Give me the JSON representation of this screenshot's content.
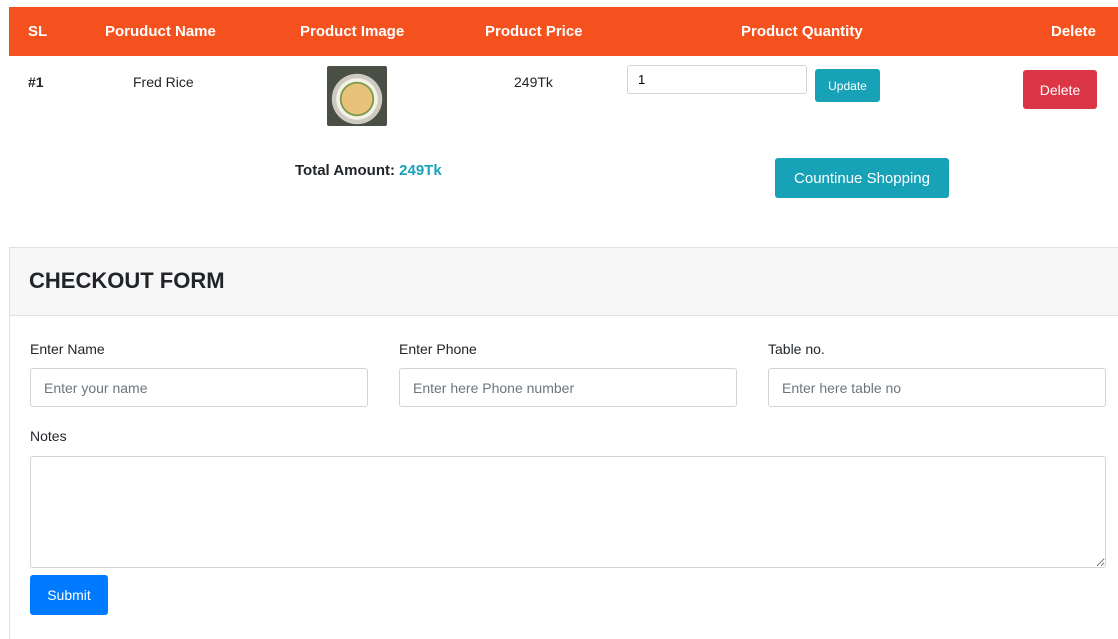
{
  "table": {
    "headers": {
      "sl": "SL",
      "name": "Poruduct Name",
      "image": "Product Image",
      "price": "Product Price",
      "quantity": "Product Quantity",
      "delete": "Delete"
    },
    "rows": [
      {
        "sl": "#1",
        "name": "Fred Rice",
        "image_icon": "fried-rice-bowl-image",
        "price": "249Tk",
        "quantity": "1",
        "update_label": "Update",
        "delete_label": "Delete"
      }
    ]
  },
  "summary": {
    "total_label": "Total Amount:",
    "total_value": "249Tk",
    "continue_label": "Countinue Shopping"
  },
  "checkout": {
    "title": "CHECKOUT FORM",
    "name_label": "Enter Name",
    "name_placeholder": "Enter your name",
    "phone_label": "Enter Phone",
    "phone_placeholder": "Enter here Phone number",
    "table_label": "Table no.",
    "table_placeholder": "Enter here table no",
    "notes_label": "Notes",
    "submit_label": "Submit"
  },
  "colors": {
    "header_bg": "#f4511e",
    "info": "#17a2b8",
    "danger": "#dc3545",
    "primary": "#007bff"
  }
}
